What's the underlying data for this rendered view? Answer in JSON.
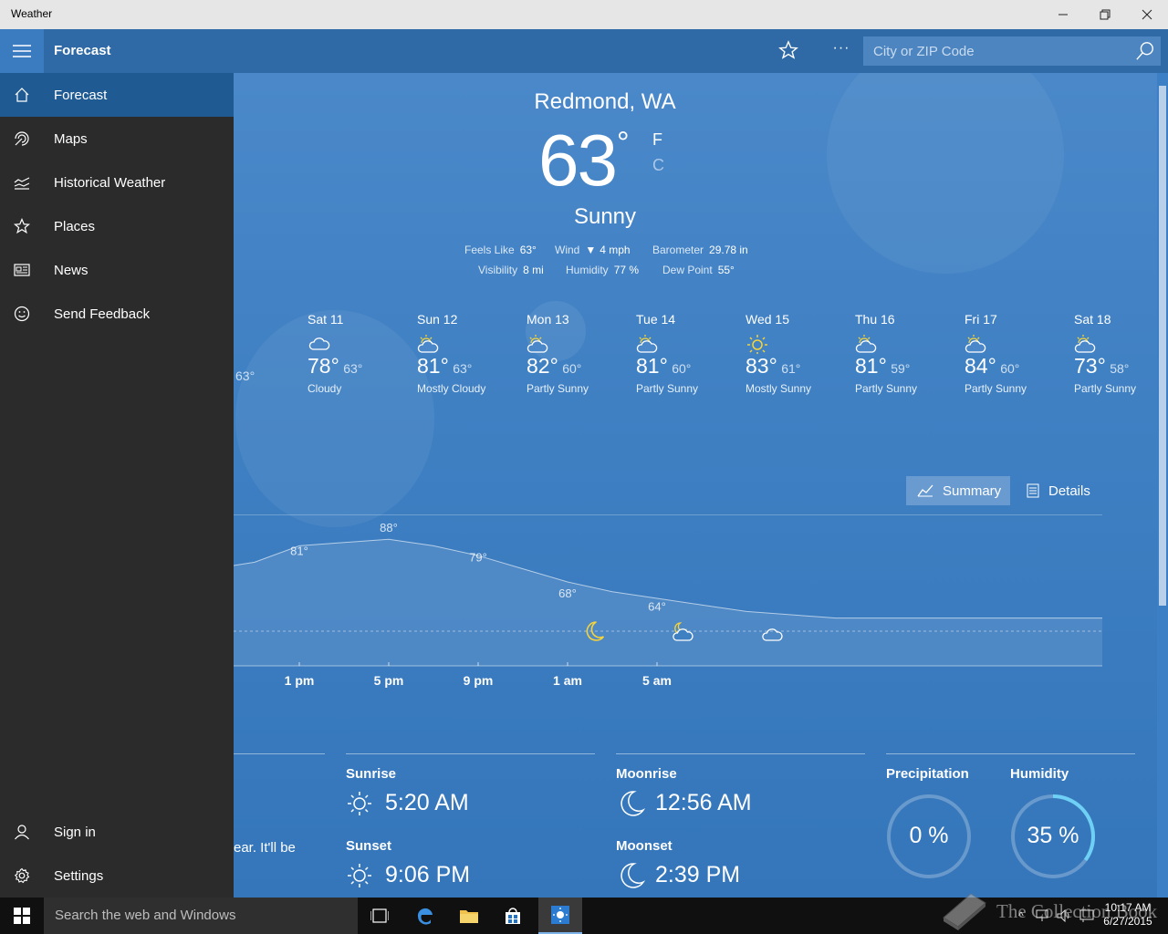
{
  "window": {
    "title": "Weather",
    "minimize_icon": "minimize-icon",
    "maximize_icon": "restore-icon",
    "close_icon": "close-icon"
  },
  "header": {
    "title": "Forecast",
    "search_placeholder": "City or ZIP Code"
  },
  "sidebar": {
    "items": [
      {
        "label": "Forecast",
        "icon": "home-icon",
        "active": true
      },
      {
        "label": "Maps",
        "icon": "radar-icon"
      },
      {
        "label": "Historical Weather",
        "icon": "chart-icon"
      },
      {
        "label": "Places",
        "icon": "star-icon"
      },
      {
        "label": "News",
        "icon": "news-icon"
      },
      {
        "label": "Send Feedback",
        "icon": "smiley-icon"
      }
    ],
    "bottom": [
      {
        "label": "Sign in",
        "icon": "person-icon"
      },
      {
        "label": "Settings",
        "icon": "gear-icon"
      }
    ]
  },
  "current": {
    "location": "Redmond, WA",
    "temp": "63",
    "deg": "°",
    "unit_f": "F",
    "unit_c": "C",
    "condition": "Sunny",
    "feels_like_label": "Feels Like",
    "feels_like": "63°",
    "wind_label": "Wind",
    "wind": "4 mph",
    "barometer_label": "Barometer",
    "barometer": "29.78 in",
    "visibility_label": "Visibility",
    "visibility": "8 mi",
    "humidity_label": "Humidity",
    "humidity": "77 %",
    "dew_point_label": "Dew Point",
    "dew_point": "55°"
  },
  "daily": {
    "partial_low": "63°",
    "days": [
      {
        "name": "Sat 11",
        "hi": "78°",
        "lo": "63°",
        "cond": "Cloudy",
        "icon": "cloudy-icon"
      },
      {
        "name": "Sun 12",
        "hi": "81°",
        "lo": "63°",
        "cond": "Mostly Cloudy",
        "icon": "partly-sunny-icon"
      },
      {
        "name": "Mon 13",
        "hi": "82°",
        "lo": "60°",
        "cond": "Partly Sunny",
        "icon": "partly-sunny-icon"
      },
      {
        "name": "Tue 14",
        "hi": "81°",
        "lo": "60°",
        "cond": "Partly Sunny",
        "icon": "partly-sunny-icon"
      },
      {
        "name": "Wed 15",
        "hi": "83°",
        "lo": "61°",
        "cond": "Mostly Sunny",
        "icon": "sunny-icon"
      },
      {
        "name": "Thu 16",
        "hi": "81°",
        "lo": "59°",
        "cond": "Partly Sunny",
        "icon": "partly-sunny-icon"
      },
      {
        "name": "Fri 17",
        "hi": "84°",
        "lo": "60°",
        "cond": "Partly Sunny",
        "icon": "partly-sunny-icon"
      },
      {
        "name": "Sat 18",
        "hi": "73°",
        "lo": "58°",
        "cond": "Partly Sunny",
        "icon": "partly-sunny-icon"
      }
    ]
  },
  "view_toggle": {
    "summary": "Summary",
    "details": "Details"
  },
  "chart_data": {
    "type": "area",
    "x": [
      "1 pm",
      "5 pm",
      "9 pm",
      "1 am",
      "5 am"
    ],
    "temp_labels": [
      "81°",
      "88°",
      "79°",
      "68°",
      "64°"
    ],
    "ylim": [
      55,
      95
    ],
    "points": [
      {
        "t": 0.0,
        "v": 80
      },
      {
        "t": 0.5,
        "v": 81
      },
      {
        "t": 1.0,
        "v": 86
      },
      {
        "t": 1.5,
        "v": 87
      },
      {
        "t": 2.0,
        "v": 88
      },
      {
        "t": 2.5,
        "v": 86
      },
      {
        "t": 3.0,
        "v": 83
      },
      {
        "t": 3.5,
        "v": 79
      },
      {
        "t": 4.0,
        "v": 75
      },
      {
        "t": 4.5,
        "v": 72
      },
      {
        "t": 5.0,
        "v": 70
      },
      {
        "t": 5.5,
        "v": 68
      },
      {
        "t": 6.0,
        "v": 66
      },
      {
        "t": 6.5,
        "v": 65
      },
      {
        "t": 7.0,
        "v": 64
      },
      {
        "t": 7.5,
        "v": 64
      },
      {
        "t": 8.0,
        "v": 64
      },
      {
        "t": 8.5,
        "v": 64
      }
    ],
    "label_t": [
      1.0,
      2.0,
      3.0,
      4.0,
      5.0
    ],
    "label_v": [
      81,
      88,
      79,
      68,
      64
    ],
    "condition_icons": [
      {
        "t": 4.3,
        "icon": "moon-icon"
      },
      {
        "t": 5.3,
        "icon": "partly-cloudy-night-icon"
      },
      {
        "t": 6.3,
        "icon": "cloudy-icon"
      }
    ]
  },
  "details": {
    "partial_text": "ear. It'll be",
    "sunrise_label": "Sunrise",
    "sunrise": "5:20 AM",
    "sunset_label": "Sunset",
    "sunset": "9:06 PM",
    "moonrise_label": "Moonrise",
    "moonrise": "12:56 AM",
    "moonset_label": "Moonset",
    "moonset": "2:39 PM",
    "precip_label": "Precipitation",
    "precip": "0 %",
    "precip_fraction": 0,
    "humidity_label": "Humidity",
    "humidity": "35 %",
    "humidity_fraction": 0.35
  },
  "taskbar": {
    "search_placeholder": "Search the web and Windows",
    "time": "10:17 AM",
    "date": "6/27/2015",
    "watermark": "The Collection Book"
  },
  "colors": {
    "accent": "#2f6aa6",
    "sidebar": "#2b2b2b",
    "active": "#1f5a92",
    "sun": "#f5d33a"
  }
}
